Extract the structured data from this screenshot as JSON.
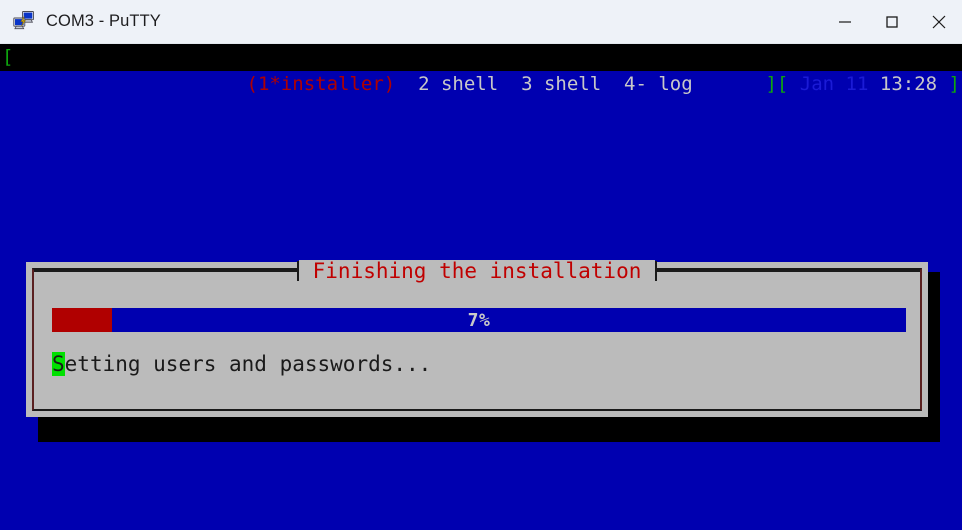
{
  "window": {
    "title": "COM3 - PuTTY",
    "icon": "putty-icon",
    "controls": {
      "minimize": "minimize-icon",
      "maximize": "maximize-icon",
      "close": "close-icon"
    }
  },
  "terminal": {
    "background_color": "#0000b0",
    "statusbar": {
      "left_bracket": "[",
      "windows": "(1*installer)  2 shell  3 shell  4- log",
      "windows_active": "(1*installer)",
      "windows_rest": "  2 shell  3 shell  4- log",
      "right_close_bracket": "]",
      "right_open_bracket": "[",
      "date": "Jan 11",
      "time": "13:28",
      "right_end_bracket": "]",
      "colors": {
        "bracket": "#0ea60e",
        "active_window": "#b00000",
        "text": "#c8c8c8",
        "date": "#1b1bd6"
      }
    }
  },
  "dialog": {
    "title": "Finishing the installation",
    "title_color": "#c00000",
    "background_color": "#bbbbbb",
    "progress": {
      "percent_label": "7%",
      "percent_value": 7,
      "fill_color": "#b00000",
      "track_color": "#0000b0"
    },
    "status_message": {
      "cursor_char": "S",
      "rest": "etting users and passwords...",
      "full": "Setting users and passwords...",
      "cursor_color": "#00e000"
    }
  }
}
